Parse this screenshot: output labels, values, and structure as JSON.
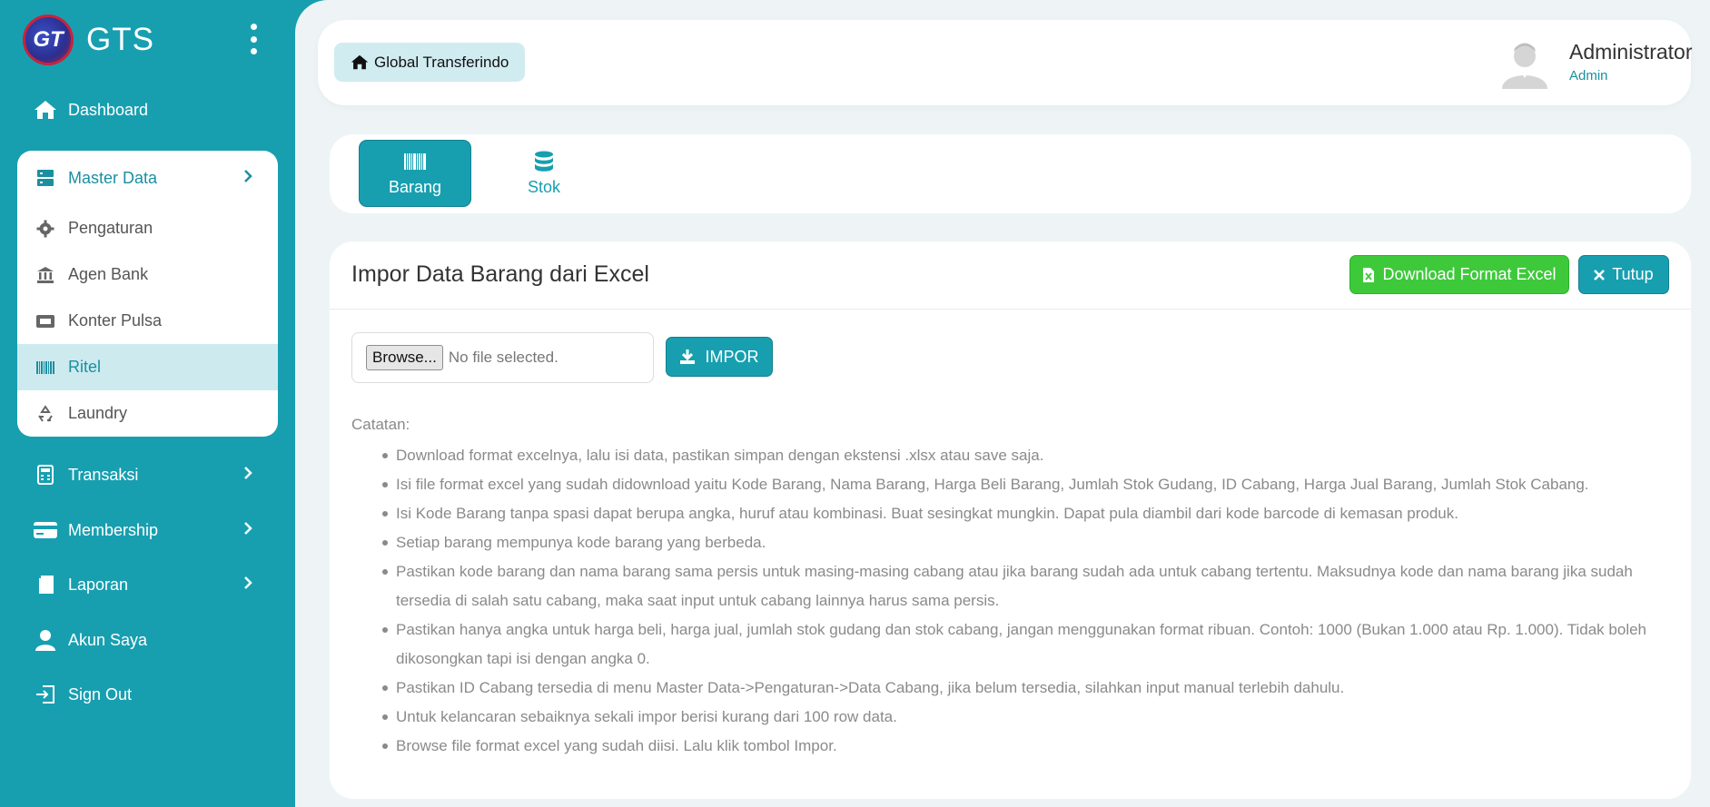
{
  "brand": {
    "name": "GTS",
    "logo_text": "GT"
  },
  "sidebar": {
    "dashboard": "Dashboard",
    "master": {
      "label": "Master Data",
      "items": [
        {
          "label": "Pengaturan",
          "icon": "gear-icon"
        },
        {
          "label": "Agen Bank",
          "icon": "bank-icon"
        },
        {
          "label": "Konter Pulsa",
          "icon": "ticket-icon"
        },
        {
          "label": "Ritel",
          "icon": "barcode-icon",
          "active": true
        },
        {
          "label": "Laundry",
          "icon": "recycle-icon"
        }
      ]
    },
    "transaksi": "Transaksi",
    "membership": "Membership",
    "laporan": "Laporan",
    "akun": "Akun Saya",
    "signout": "Sign Out"
  },
  "header": {
    "breadcrumb": "Global Transferindo",
    "user_name": "Administrator",
    "user_role": "Admin"
  },
  "tabs": [
    {
      "label": "Barang",
      "icon": "barcode-icon",
      "active": true
    },
    {
      "label": "Stok",
      "icon": "database-icon",
      "active": false
    }
  ],
  "card": {
    "title": "Impor Data Barang dari Excel",
    "download_label": "Download Format Excel",
    "close_label": "Tutup",
    "browse_label": "Browse...",
    "file_status": "No file selected.",
    "import_label": "IMPOR",
    "notes_title": "Catatan:",
    "notes": [
      "Download format excelnya, lalu isi data, pastikan simpan dengan ekstensi .xlsx atau save saja.",
      "Isi file format excel yang sudah didownload yaitu Kode Barang, Nama Barang, Harga Beli Barang, Jumlah Stok Gudang, ID Cabang, Harga Jual Barang, Jumlah Stok Cabang.",
      "Isi Kode Barang tanpa spasi dapat berupa angka, huruf atau kombinasi. Buat sesingkat mungkin. Dapat pula diambil dari kode barcode di kemasan produk.",
      "Setiap barang mempunya kode barang yang berbeda.",
      "Pastikan kode barang dan nama barang sama persis untuk masing-masing cabang atau jika barang sudah ada untuk cabang tertentu. Maksudnya kode dan nama barang jika sudah tersedia di salah satu cabang, maka saat input untuk cabang lainnya harus sama persis.",
      "Pastikan hanya angka untuk harga beli, harga jual, jumlah stok gudang dan stok cabang, jangan menggunakan format ribuan. Contoh: 1000 (Bukan 1.000 atau Rp. 1.000). Tidak boleh dikosongkan tapi isi dengan angka 0.",
      "Pastikan ID Cabang tersedia di menu Master Data->Pengaturan->Data Cabang, jika belum tersedia, silahkan input manual terlebih dahulu.",
      "Untuk kelancaran sebaiknya sekali impor berisi kurang dari 100 row data.",
      "Browse file format excel yang sudah diisi. Lalu klik tombol Impor."
    ]
  },
  "colors": {
    "primary": "#179fb0",
    "green": "#3ec93b",
    "bg": "#eef4f6",
    "active_bg": "#cdebef"
  }
}
